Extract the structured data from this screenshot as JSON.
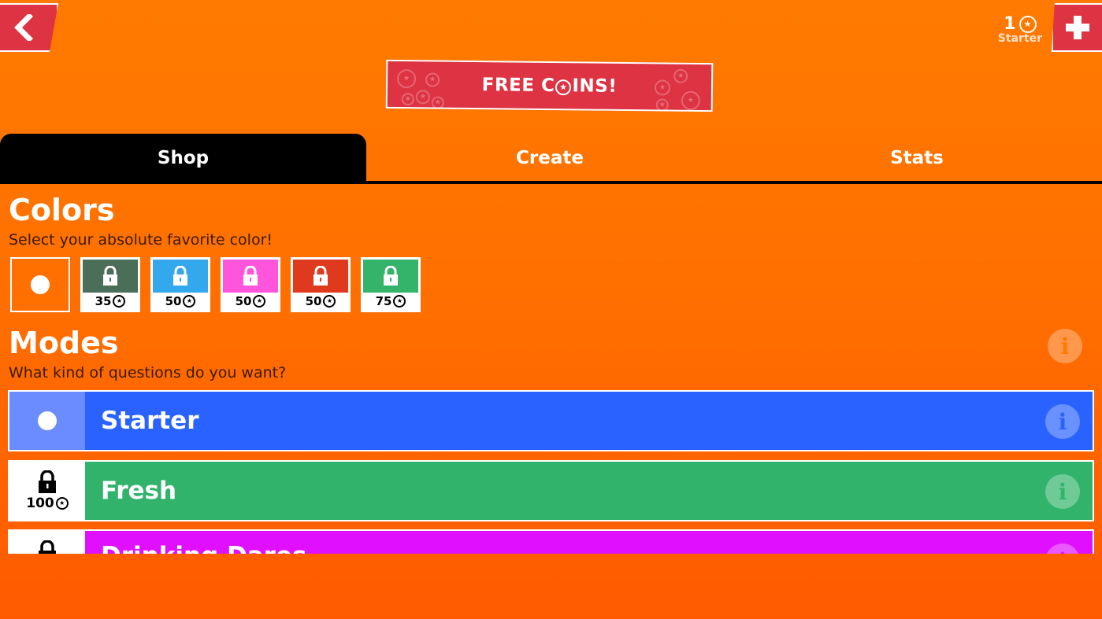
{
  "header": {
    "coin_count": "1",
    "coin_symbol": "✪",
    "mode_label": "Starter",
    "free_coins_label": "FREE C◎INS!",
    "free_coins_left": "FREE C",
    "free_coins_right": "INS!"
  },
  "tabs": [
    {
      "label": "Shop",
      "active": true
    },
    {
      "label": "Create",
      "active": false
    },
    {
      "label": "Stats",
      "active": false
    }
  ],
  "colors_section": {
    "title": "Colors",
    "subtitle": "Select your absolute favorite color!",
    "swatches": [
      {
        "color": "#ff7000",
        "selected": true,
        "locked": false,
        "price": ""
      },
      {
        "color": "#4a6e58",
        "selected": false,
        "locked": true,
        "price": "35"
      },
      {
        "color": "#34a8ec",
        "selected": false,
        "locked": true,
        "price": "50"
      },
      {
        "color": "#ff55dd",
        "selected": false,
        "locked": true,
        "price": "50"
      },
      {
        "color": "#e03a1e",
        "selected": false,
        "locked": true,
        "price": "50"
      },
      {
        "color": "#34b36a",
        "selected": false,
        "locked": true,
        "price": "75"
      }
    ]
  },
  "modes_section": {
    "title": "Modes",
    "subtitle": "What kind of questions do you want?",
    "modes": [
      {
        "name": "Starter",
        "color": "#2962ff",
        "left_color": "#6b8cff",
        "selected": true,
        "locked": false,
        "price": ""
      },
      {
        "name": "Fresh",
        "color": "#31b36c",
        "selected": false,
        "locked": true,
        "price": "100"
      },
      {
        "name": "Drinking Dares",
        "color": "#e010ff",
        "selected": false,
        "locked": true,
        "price": ""
      }
    ]
  },
  "icons": {
    "back": "chevron-left-icon",
    "plus": "plus-icon",
    "lock": "lock-icon",
    "info": "info-icon",
    "coin": "coin-icon"
  }
}
